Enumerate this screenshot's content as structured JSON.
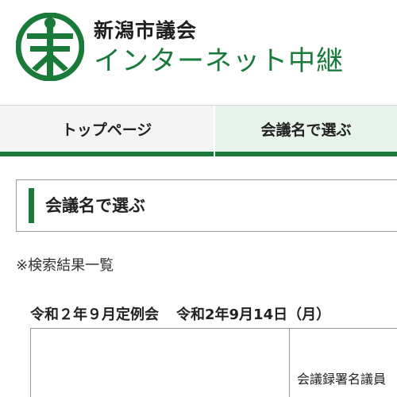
{
  "header": {
    "title_line1": "新潟市議会",
    "title_line2": "インターネット中継"
  },
  "nav": {
    "tabs": [
      {
        "label": "トップページ"
      },
      {
        "label": "会議名で選ぶ"
      }
    ]
  },
  "section": {
    "title": "会議名で選ぶ"
  },
  "results": {
    "label": "※検索結果一覧",
    "meeting_name": "令和２年９月定例会",
    "meeting_date": "令和2年9月14日（月）",
    "cell_text": "会議録署名議員"
  },
  "colors": {
    "accent": "#1a7a3a",
    "active_tab_bg": "#e6f4ec"
  },
  "icons": {
    "logo": "niigata-city-emblem-icon"
  }
}
